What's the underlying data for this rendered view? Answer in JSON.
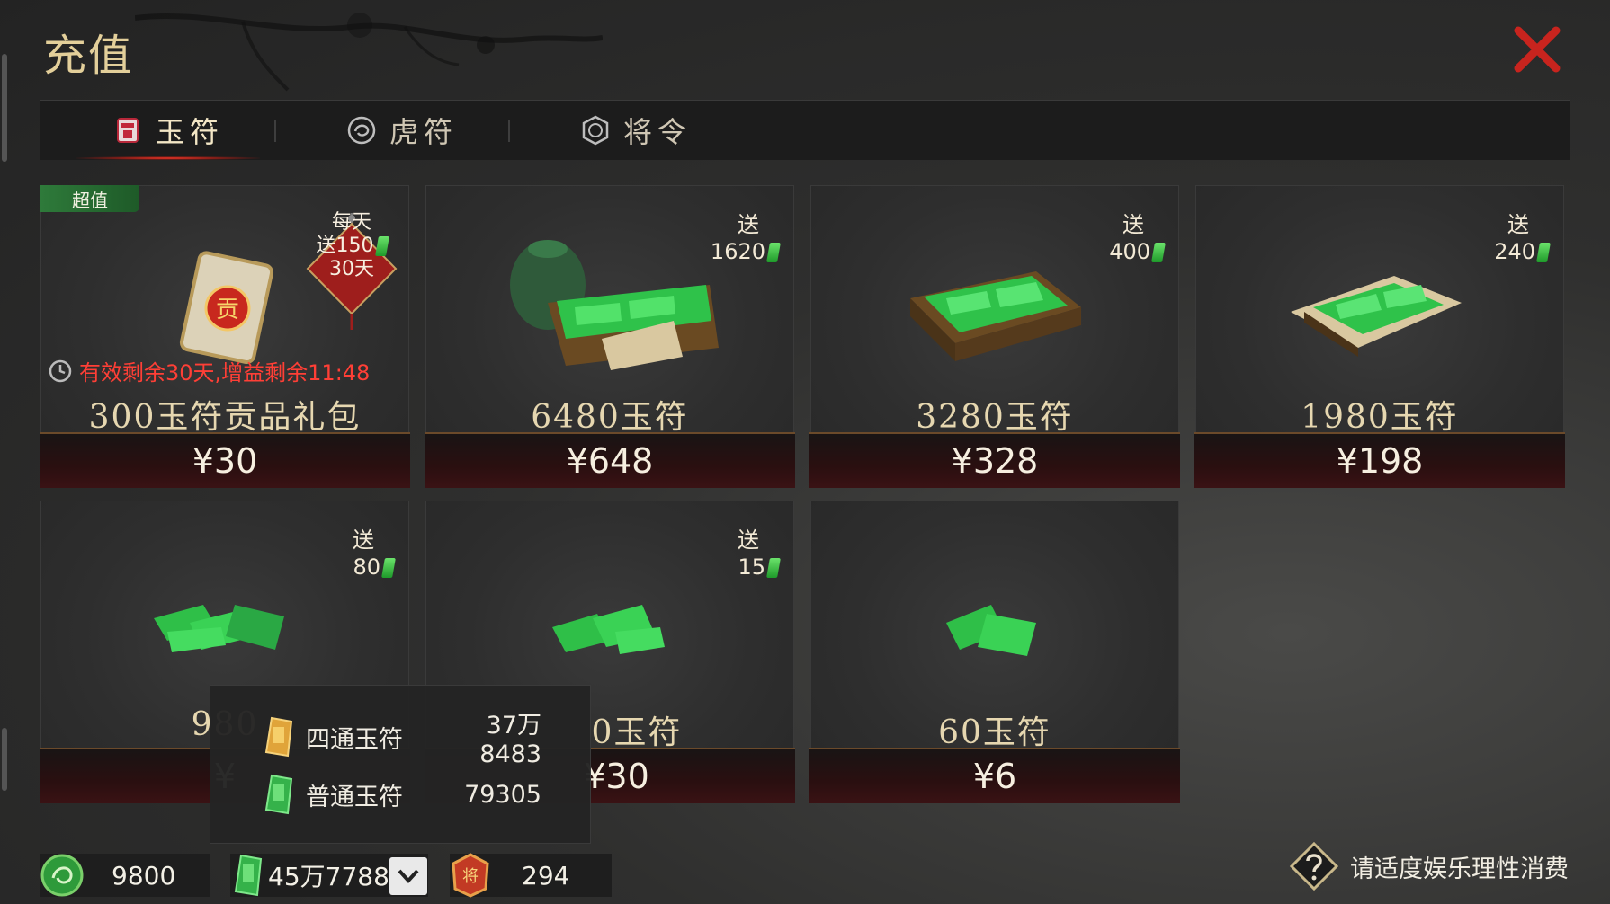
{
  "title": "充值",
  "colors": {
    "accent_red": "#ff3a2a",
    "jade_green": "#2fb53a",
    "gold_text": "#e3cf9a"
  },
  "tabs": [
    {
      "label": "玉符",
      "icon": "jade-token-icon",
      "active": true
    },
    {
      "label": "虎符",
      "icon": "tiger-token-icon",
      "active": false
    },
    {
      "label": "将令",
      "icon": "general-order-icon",
      "active": false
    }
  ],
  "packs": [
    {
      "badge": "超值",
      "daily_label": "每天",
      "daily_gift": "送150",
      "daily_days": "30天",
      "timer": "有效剩余30天,增益剩余11:48",
      "name": "300玉符贡品礼包",
      "price": "¥30",
      "icon": "tribute-card-icon"
    },
    {
      "gift_label": "送",
      "gift_amount": "1620",
      "name": "6480玉符",
      "price": "¥648",
      "icon": "jade-chest-icon"
    },
    {
      "gift_label": "送",
      "gift_amount": "400",
      "name": "3280玉符",
      "price": "¥328",
      "icon": "jade-tray-icon"
    },
    {
      "gift_label": "送",
      "gift_amount": "240",
      "name": "1980玉符",
      "price": "¥198",
      "icon": "jade-cloth-icon"
    },
    {
      "gift_label": "送",
      "gift_amount": "80",
      "name": "980",
      "price": "¥",
      "icon": "jade-pile-icon"
    },
    {
      "gift_label": "送",
      "gift_amount": "15",
      "name": "0玉符",
      "price": "¥30",
      "icon": "jade-small-pile-icon"
    },
    {
      "name": "60玉符",
      "price": "¥6",
      "icon": "jade-pair-icon"
    }
  ],
  "tooltip": {
    "rows": [
      {
        "label": "四通玉符",
        "value": "37万8483",
        "icon": "gold-jade-icon"
      },
      {
        "label": "普通玉符",
        "value": "79305",
        "icon": "green-jade-icon"
      }
    ]
  },
  "resources": {
    "coins": "9800",
    "jade": "45万7788",
    "orders": "294"
  },
  "notice": "请适度娱乐理性消费"
}
